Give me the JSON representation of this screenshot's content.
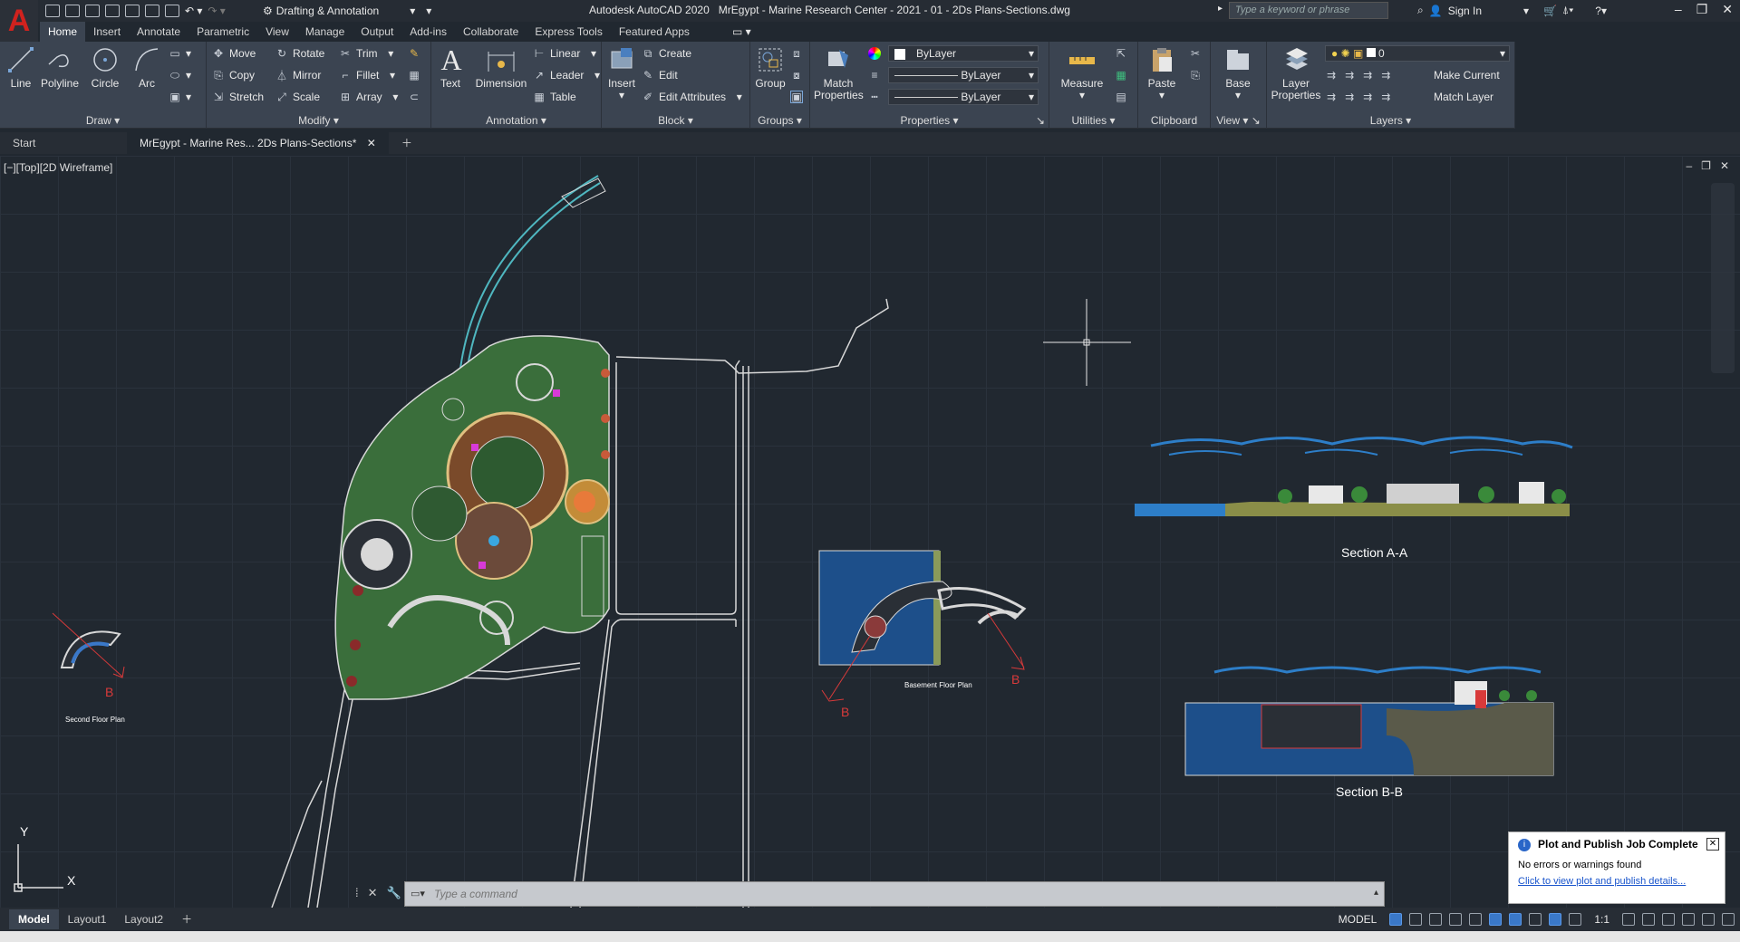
{
  "title_bar": {
    "app_letter": "A",
    "workspace": "Drafting & Annotation",
    "app_title": "Autodesk AutoCAD 2020",
    "document_title": "MrEgypt - Marine Research Center - 2021 - 01 - 2Ds Plans-Sections.dwg",
    "search_placeholder": "Type a keyword or phrase",
    "sign_in": "Sign In"
  },
  "ribbon_tabs": [
    "Home",
    "Insert",
    "Annotate",
    "Parametric",
    "View",
    "Manage",
    "Output",
    "Add-ins",
    "Collaborate",
    "Express Tools",
    "Featured Apps"
  ],
  "ribbon": {
    "draw": {
      "title": "Draw",
      "line": "Line",
      "polyline": "Polyline",
      "circle": "Circle",
      "arc": "Arc"
    },
    "modify": {
      "title": "Modify",
      "move": "Move",
      "rotate": "Rotate",
      "trim": "Trim",
      "copy": "Copy",
      "mirror": "Mirror",
      "fillet": "Fillet",
      "stretch": "Stretch",
      "scale": "Scale",
      "array": "Array"
    },
    "annotation": {
      "title": "Annotation",
      "text": "Text",
      "dimension": "Dimension",
      "linear": "Linear",
      "leader": "Leader",
      "table": "Table"
    },
    "block": {
      "title": "Block",
      "insert": "Insert",
      "create": "Create",
      "edit": "Edit",
      "edit_attributes": "Edit Attributes"
    },
    "groups": {
      "title": "Groups",
      "group": "Group"
    },
    "properties": {
      "title": "Properties",
      "match_properties": "Match Properties",
      "color": "ByLayer",
      "linetype": "ByLayer",
      "lineweight": "ByLayer"
    },
    "utilities": {
      "title": "Utilities",
      "measure": "Measure"
    },
    "clipboard": {
      "title": "Clipboard",
      "paste": "Paste"
    },
    "view": {
      "title": "View",
      "base": "Base"
    },
    "layers": {
      "title": "Layers",
      "layer_properties": "Layer Properties",
      "current_layer": "0",
      "make_current": "Make Current",
      "match_layer": "Match Layer"
    }
  },
  "doc_tabs": [
    "Start",
    "MrEgypt - Marine Res... 2Ds Plans-Sections*"
  ],
  "viewport": {
    "label": "[−][Top][2D Wireframe]"
  },
  "drawing_labels": {
    "section_aa": "Section A-A",
    "section_bb": "Section B-B",
    "second_floor": "Second Floor Plan",
    "basement_floor": "Basement Floor Plan",
    "marker_b": "B",
    "ucs_x": "X",
    "ucs_y": "Y"
  },
  "notification": {
    "title": "Plot and Publish Job Complete",
    "message": "No errors or warnings found",
    "link": "Click to view plot and publish details..."
  },
  "command_line": {
    "placeholder": "Type a command"
  },
  "layout_tabs": [
    "Model",
    "Layout1",
    "Layout2"
  ],
  "status": {
    "mode": "MODEL",
    "scale": "1:1"
  },
  "colors": {
    "canvas": "#212830",
    "ribbon": "#3b4451",
    "accent_red": "#d0221e",
    "water": "#1d5fa8",
    "vegetation": "#2f8a3a"
  }
}
